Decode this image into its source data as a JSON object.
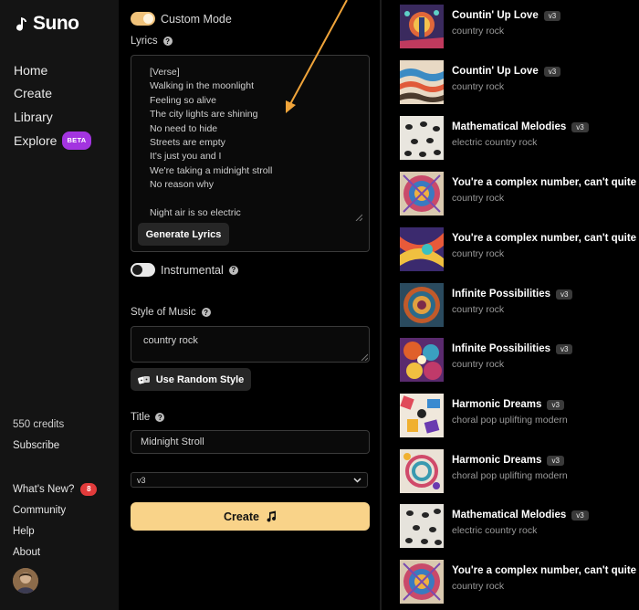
{
  "sidebar": {
    "logo": "Suno",
    "nav": [
      {
        "label": "Home"
      },
      {
        "label": "Create"
      },
      {
        "label": "Library"
      },
      {
        "label": "Explore",
        "badge": "BETA"
      }
    ],
    "credits": "550 credits",
    "subscribe": "Subscribe",
    "links": [
      {
        "label": "What's New?",
        "badge": "8"
      },
      {
        "label": "Community"
      },
      {
        "label": "Help"
      },
      {
        "label": "About"
      }
    ]
  },
  "create": {
    "custom_mode": {
      "label": "Custom Mode",
      "on": true
    },
    "lyrics_label": "Lyrics",
    "lyrics": "[Verse]\nWalking in the moonlight\nFeeling so alive\nThe city lights are shining\nNo need to hide\nStreets are empty\nIt's just you and I\nWe're taking a midnight stroll\nNo reason why\n\nNight air is so electric",
    "generate_lyrics": "Generate Lyrics",
    "instrumental": {
      "label": "Instrumental",
      "on": false
    },
    "style_label": "Style of Music",
    "style_value": "country rock",
    "random_style": "Use Random Style",
    "title_label": "Title",
    "title_value": "Midnight Stroll",
    "model": "v3",
    "create_button": "Create"
  },
  "songs": [
    {
      "title": "Countin' Up Love",
      "version": "v3",
      "style": "country rock"
    },
    {
      "title": "Countin' Up Love",
      "version": "v3",
      "style": "country rock"
    },
    {
      "title": "Mathematical Melodies",
      "version": "v3",
      "style": "electric country rock"
    },
    {
      "title": "You're a complex number, can't quite figure you out",
      "version": "",
      "style": "country rock"
    },
    {
      "title": "You're a complex number, can't quite figure you out",
      "version": "",
      "style": "country rock"
    },
    {
      "title": "Infinite Possibilities",
      "version": "v3",
      "style": "country rock"
    },
    {
      "title": "Infinite Possibilities",
      "version": "v3",
      "style": "country rock"
    },
    {
      "title": "Harmonic Dreams",
      "version": "v3",
      "style": "choral pop uplifting modern"
    },
    {
      "title": "Harmonic Dreams",
      "version": "v3",
      "style": "choral pop uplifting modern"
    },
    {
      "title": "Mathematical Melodies",
      "version": "v3",
      "style": "electric country rock"
    },
    {
      "title": "You're a complex number, can't quite figure you out",
      "version": "",
      "style": "country rock"
    }
  ],
  "colors": {
    "accent_toggle": "#f0c27a",
    "create_button": "#f9d389",
    "beta_badge": "#a334e0",
    "new_badge": "#e23b3b",
    "annotation_arrow": "#f0a43a"
  },
  "icons": {
    "logo": "music-note-icon",
    "help": "question-circle-icon",
    "dice": "dice-icon",
    "create": "music-note-icon",
    "select": "chevron-down-icon"
  }
}
